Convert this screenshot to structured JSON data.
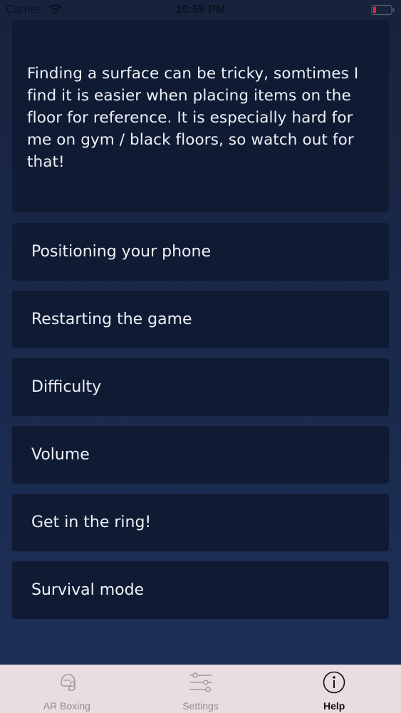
{
  "status_bar": {
    "carrier": "Carrier",
    "time": "10:59 PM",
    "battery_color": "#e0283a"
  },
  "expanded": {
    "text": "Finding a surface can be tricky, somtimes I find it is easier when placing items on the floor for reference. It is especially hard for me on gym / black floors, so watch out for that!"
  },
  "items": [
    {
      "label": "Positioning your phone"
    },
    {
      "label": "Restarting the game"
    },
    {
      "label": "Difficulty"
    },
    {
      "label": "Volume"
    },
    {
      "label": "Get in the ring!"
    },
    {
      "label": "Survival mode"
    }
  ],
  "tabs": [
    {
      "label": "AR Boxing",
      "icon": "boxing-headgear-icon",
      "active": false
    },
    {
      "label": "Settings",
      "icon": "sliders-icon",
      "active": false
    },
    {
      "label": "Help",
      "icon": "info-icon",
      "active": true
    }
  ],
  "colors": {
    "background": "#1a2a4e",
    "card": "#0f1a33",
    "tab_bar": "#e9dde2",
    "text": "#eef1f6"
  }
}
